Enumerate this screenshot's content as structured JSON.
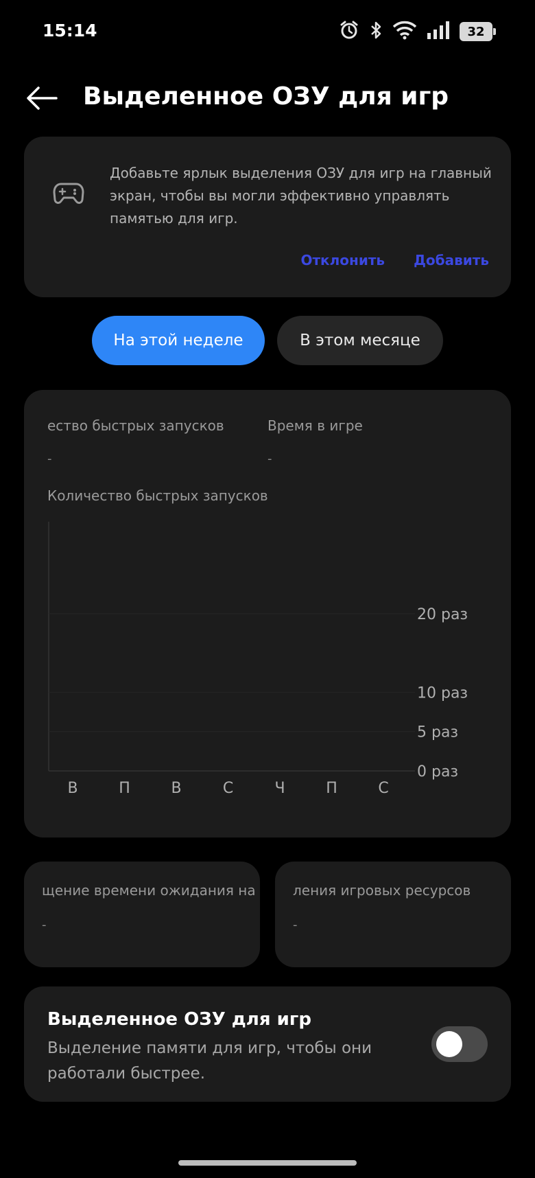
{
  "status_bar": {
    "time": "15:14",
    "battery": "32",
    "icons": [
      "alarm-icon",
      "bluetooth-icon",
      "wifi-icon",
      "signal-icon",
      "battery-icon"
    ]
  },
  "header": {
    "title": "Выделенное ОЗУ для игр",
    "back_icon": "arrow-left-icon"
  },
  "promo": {
    "icon": "gamepad-icon",
    "text": "Добавьте ярлык выделения ОЗУ для игр на главный экран, чтобы вы могли эффективно управлять памятью для игр.",
    "dismiss_label": "Отклонить",
    "add_label": "Добавить"
  },
  "period_tabs": {
    "week": "На этой неделе",
    "month": "В этом месяце",
    "selected": "week"
  },
  "stats": {
    "launches_label": "ество быстрых запусков",
    "launches_value": "-",
    "playtime_label": "Время в игре",
    "playtime_value": "-"
  },
  "chart_data": {
    "type": "bar",
    "title": "Количество быстрых запусков",
    "categories": [
      "В",
      "П",
      "В",
      "С",
      "Ч",
      "П",
      "С"
    ],
    "values": [
      0,
      0,
      0,
      0,
      0,
      0,
      0
    ],
    "y_ticks": [
      "20 раз",
      "10 раз",
      "5 раз",
      "0 раз"
    ],
    "y_tick_values": [
      20,
      10,
      5,
      0
    ],
    "grid": true,
    "xlabel": "",
    "ylabel": ""
  },
  "small_cards": [
    {
      "label": "щение времени ожидания на",
      "value": "-"
    },
    {
      "label": "ления игровых ресурсов",
      "value": "-"
    }
  ],
  "ram_toggle": {
    "title": "Выделенное ОЗУ для игр",
    "description": "Выделение памяти для игр, чтобы они работали быстрее.",
    "enabled": false
  },
  "colors": {
    "accent": "#2e86f7",
    "link": "#3b48e0",
    "card": "#1c1c1c",
    "background": "#000000"
  }
}
